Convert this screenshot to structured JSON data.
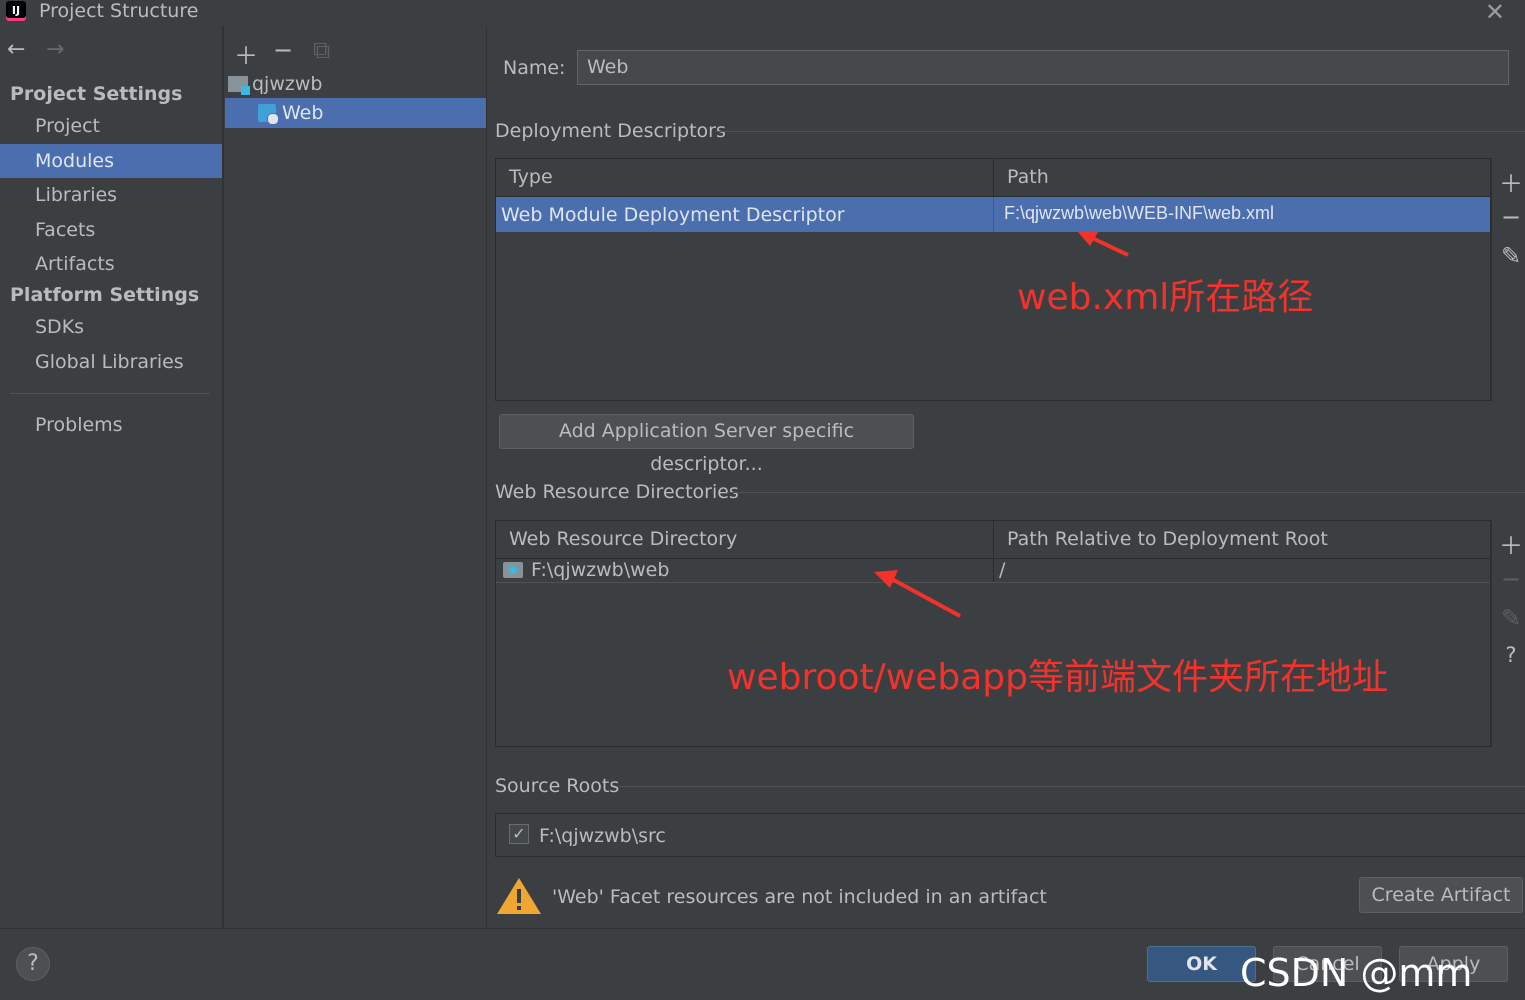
{
  "window": {
    "title": "Project Structure",
    "logo_text": "IJ"
  },
  "nav": {
    "back": "←",
    "forward": "→"
  },
  "sidebar": {
    "project_settings_header": "Project Settings",
    "platform_settings_header": "Platform Settings",
    "items": [
      {
        "label": "Project",
        "selected": false
      },
      {
        "label": "Modules",
        "selected": true
      },
      {
        "label": "Libraries",
        "selected": false
      },
      {
        "label": "Facets",
        "selected": false
      },
      {
        "label": "Artifacts",
        "selected": false
      }
    ],
    "platform_items": [
      {
        "label": "SDKs"
      },
      {
        "label": "Global Libraries"
      }
    ],
    "problems": "Problems"
  },
  "tree": {
    "root": "qjwzwb",
    "child": "Web"
  },
  "main": {
    "name_label": "Name:",
    "name_value": "Web",
    "deployment": {
      "title": "Deployment Descriptors",
      "columns": [
        "Type",
        "Path"
      ],
      "rows": [
        {
          "type": "Web Module Deployment Descriptor",
          "path": "F:\\qjwzwb\\web\\WEB-INF\\web.xml"
        }
      ],
      "annotation": "web.xml所在路径",
      "add_button": "Add Application Server specific descriptor..."
    },
    "resources": {
      "title": "Web Resource Directories",
      "columns": [
        "Web Resource Directory",
        "Path Relative to Deployment Root"
      ],
      "rows": [
        {
          "dir": "F:\\qjwzwb\\web",
          "rel": "/"
        }
      ],
      "annotation": "webroot/webapp等前端文件夹所在地址"
    },
    "source_roots": {
      "title": "Source Roots",
      "items": [
        {
          "path": "F:\\qjwzwb\\src",
          "checked": true
        }
      ]
    },
    "warning": {
      "text": "'Web' Facet resources are not included in an artifact",
      "button": "Create Artifact"
    }
  },
  "footer": {
    "help": "?",
    "ok": "OK",
    "cancel": "Cancel",
    "apply": "Apply",
    "watermark": "CSDN @mm"
  },
  "colors": {
    "background": "#3c3f41",
    "selection": "#4b6eaf",
    "annotation_red": "#f4322c",
    "ok_button": "#365880"
  }
}
